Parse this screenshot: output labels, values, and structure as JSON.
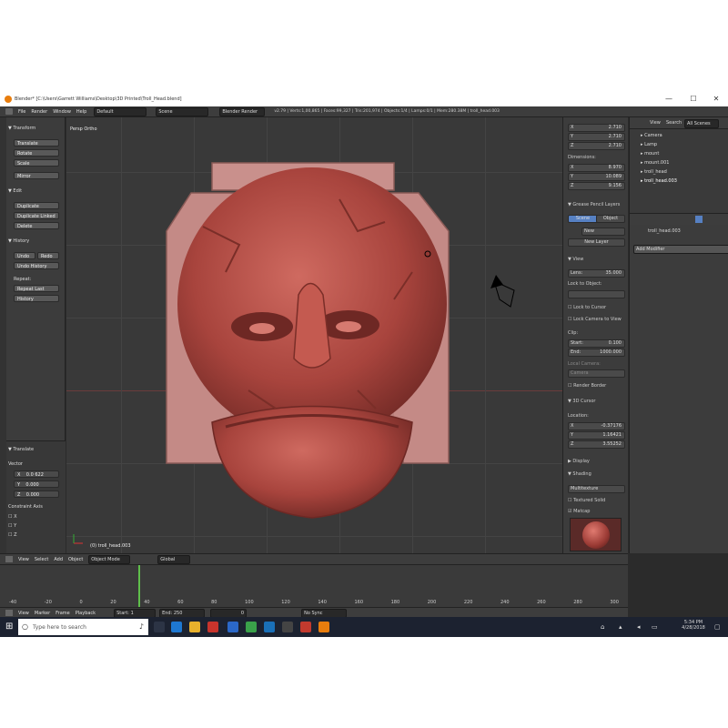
{
  "window": {
    "title": "Blender* [C:\\Users\\Garrett Williams\\Desktop\\3D Printed\\Troll_Head.blend]",
    "minimize": "—",
    "maximize": "☐",
    "close": "✕"
  },
  "menubar": {
    "items": [
      "File",
      "Render",
      "Window",
      "Help"
    ],
    "layout": "Default",
    "scene": "Scene",
    "engine": "Blender Render",
    "stats": "v2.79 | Verts:1,00,865 | Faces:99,327 | Tris:201,974 | Objects:1/4 | Lamps:0/1 | Mem:280.38M | troll_head.003"
  },
  "toolshelf": {
    "transform_header": "▼ Transform",
    "transform_buttons": [
      "Translate",
      "Rotate",
      "Scale",
      "Mirror"
    ],
    "edit_header": "▼ Edit",
    "edit_buttons": [
      "Duplicate",
      "Duplicate Linked",
      "Delete"
    ],
    "history_header": "▼ History",
    "undo": "Undo",
    "redo": "Redo",
    "undo_history": "Undo History",
    "repeat_label": "Repeat:",
    "repeat_last": "Repeat Last",
    "history": "History",
    "operator_header": "▼ Translate",
    "vector_label": "Vector",
    "vector": [
      {
        "axis": "X",
        "value": "0.0 622"
      },
      {
        "axis": "Y",
        "value": "0.000"
      },
      {
        "axis": "Z",
        "value": "0.000"
      }
    ],
    "constraint_label": "Constraint Axis",
    "constraint_axes": [
      "X",
      "Y",
      "Z"
    ]
  },
  "viewport": {
    "view_label": "Persp Ortho",
    "object_label": "(0) troll_head.003"
  },
  "npanel": {
    "scale": [
      {
        "axis": "X",
        "value": "2.710"
      },
      {
        "axis": "Y",
        "value": "2.710"
      },
      {
        "axis": "Z",
        "value": "2.710"
      }
    ],
    "dimensions_label": "Dimensions:",
    "dimensions": [
      {
        "axis": "X",
        "value": "8.970"
      },
      {
        "axis": "Y",
        "value": "10.089"
      },
      {
        "axis": "Z",
        "value": "9.156"
      }
    ],
    "grease_header": "▼ Grease Pencil Layers",
    "scene_tab": "Scene",
    "object_tab": "Object",
    "new_label": "New",
    "new_layer": "New Layer",
    "view_header": "▼ View",
    "lens": "Lens:",
    "lens_value": "35.000",
    "lock_to_object": "Lock to Object:",
    "lock_to_cursor": "Lock to Cursor",
    "lock_camera": "Lock Camera to View",
    "clip_label": "Clip:",
    "start": "Start:",
    "start_value": "0.100",
    "end": "End:",
    "end_value": "1000.000",
    "local_camera": "Local Camera:",
    "camera": "Camera",
    "render_border": "Render Border",
    "cursor_header": "▼ 3D Cursor",
    "location_label": "Location:",
    "location": [
      {
        "axis": "X",
        "value": "-0.37176"
      },
      {
        "axis": "Y",
        "value": "1.16421"
      },
      {
        "axis": "Z",
        "value": "3.55252"
      }
    ],
    "display_header": "▶ Display",
    "shading_header": "▼ Shading",
    "shading_mode": "Multitexture",
    "textured_solid": "Textured Solid",
    "matcap": "Matcap"
  },
  "outliner": {
    "view": "View",
    "search": "Search",
    "scenes": "All Scenes",
    "items": [
      "Camera",
      "Lamp",
      "mount",
      "mount.001",
      "troll_head",
      "troll_head.003"
    ]
  },
  "properties": {
    "object_name": "troll_head.003",
    "add_modifier": "Add Modifier"
  },
  "vheader": {
    "items": [
      "View",
      "Select",
      "Add",
      "Object"
    ],
    "mode": "Object Mode",
    "orientation": "Global"
  },
  "timeline": {
    "ticks": [
      "-40",
      "-20",
      "0",
      "20",
      "40",
      "60",
      "80",
      "100",
      "120",
      "140",
      "160",
      "180",
      "200",
      "220",
      "240",
      "260",
      "280",
      "300"
    ],
    "items": [
      "View",
      "Marker",
      "Frame",
      "Playback"
    ],
    "start": "Start:",
    "start_value": "1",
    "end": "End:",
    "end_value": "250",
    "current": "0",
    "sync": "No Sync"
  },
  "taskbar": {
    "search_placeholder": "Type here to search",
    "time": "5:34 PM",
    "date": "4/28/2018"
  },
  "colors": {
    "model": "#b85048",
    "ui_dark": "#3c3c3c",
    "accent_blue": "#5680c2",
    "accent_orange": "#e87d0d"
  }
}
